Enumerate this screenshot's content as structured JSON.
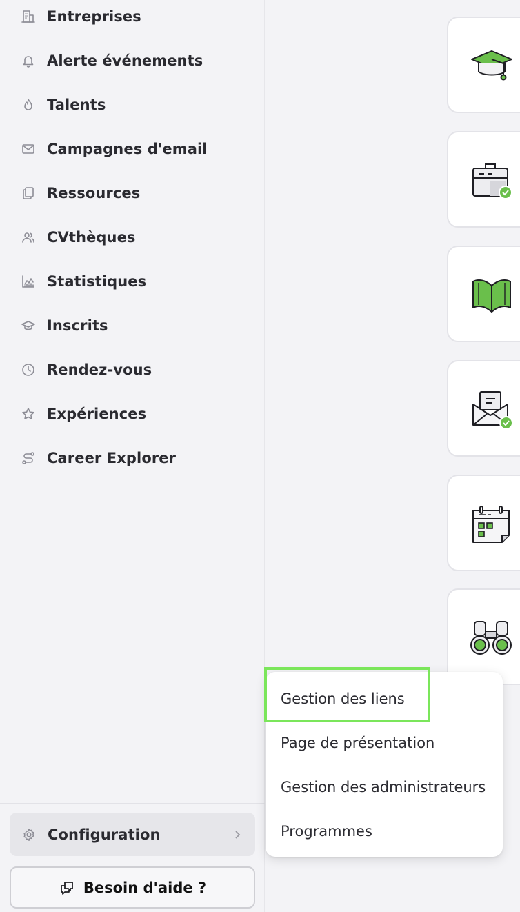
{
  "sidebar": {
    "items": [
      {
        "label": "Entreprises",
        "icon": "building-icon"
      },
      {
        "label": "Alerte événements",
        "icon": "bell-icon"
      },
      {
        "label": "Talents",
        "icon": "flame-icon"
      },
      {
        "label": "Campagnes d'email",
        "icon": "mail-icon"
      },
      {
        "label": "Ressources",
        "icon": "documents-icon"
      },
      {
        "label": "CVthèques",
        "icon": "users-icon"
      },
      {
        "label": "Statistiques",
        "icon": "chart-icon"
      },
      {
        "label": "Inscrits",
        "icon": "graduation-cap-icon"
      },
      {
        "label": "Rendez-vous",
        "icon": "clock-icon"
      },
      {
        "label": "Expériences",
        "icon": "star-icon"
      },
      {
        "label": "Career Explorer",
        "icon": "route-icon"
      }
    ],
    "config": {
      "label": "Configuration",
      "icon": "gear-icon"
    },
    "help": {
      "label": "Besoin d'aide ?",
      "icon": "chat-icon"
    }
  },
  "cards": [
    {
      "icon": "graduation-cap-illustration"
    },
    {
      "icon": "briefcase-check-illustration"
    },
    {
      "icon": "book-illustration"
    },
    {
      "icon": "envelope-check-illustration"
    },
    {
      "icon": "calendar-illustration"
    },
    {
      "icon": "binoculars-illustration"
    }
  ],
  "config_menu": {
    "items": [
      "Gestion des liens",
      "Page de présentation",
      "Gestion des administrateurs",
      "Programmes"
    ],
    "highlighted": "Gestion des liens"
  },
  "colors": {
    "accent_green": "#6abf4b",
    "highlight_green": "#7be65b",
    "background": "#f3f3f6"
  }
}
